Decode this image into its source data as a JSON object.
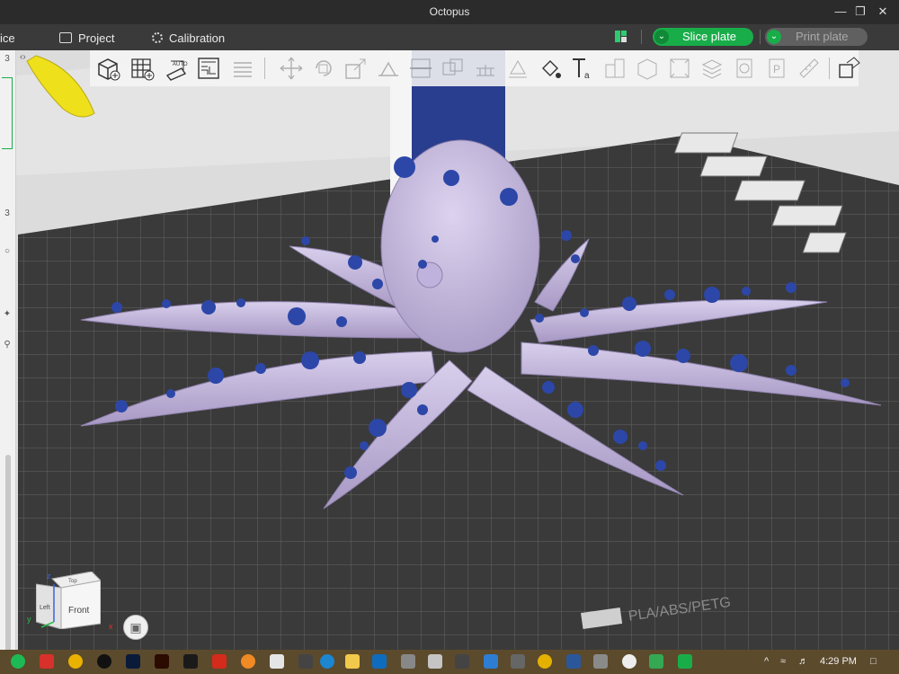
{
  "window": {
    "title": "Octopus"
  },
  "menubar": {
    "prepare_fragment": "ice",
    "project_label": "Project",
    "calibration_label": "Calibration",
    "slice_label": "Slice plate",
    "print_label": "Print plate"
  },
  "plate": {
    "label": "PLA/ABS/PETG"
  },
  "navcube": {
    "top": "Top",
    "front": "Front",
    "left": "Left",
    "axis_x": "x",
    "axis_y": "y",
    "axis_z": "z"
  },
  "leftstrip": {
    "n1": "3",
    "n2": "3"
  },
  "taskbar": {
    "time": "4:29 PM"
  },
  "colors": {
    "accent": "#19ad4a",
    "model_body": "#c9bde0",
    "model_spots": "#2c47a8",
    "bed": "#3b3b3b",
    "other_model": "#f0e21a",
    "support_pillar": "#2a3e8f"
  },
  "icons": [
    "add-object-icon",
    "add-plate-icon",
    "auto-orient-icon",
    "arrange-icon",
    "split-icon",
    "move-icon",
    "rotate-icon",
    "scale-icon",
    "place-on-face-icon",
    "cut-icon",
    "mesh-boolean-icon",
    "support-paint-icon",
    "seam-paint-icon",
    "color-paint-icon",
    "text-icon",
    "assembly-icon",
    "measure-icon",
    "layers-icon",
    "view-icon",
    "brim-icon",
    "emboss-icon",
    "variable-layer-icon",
    "ruler-icon",
    "search-icon"
  ]
}
